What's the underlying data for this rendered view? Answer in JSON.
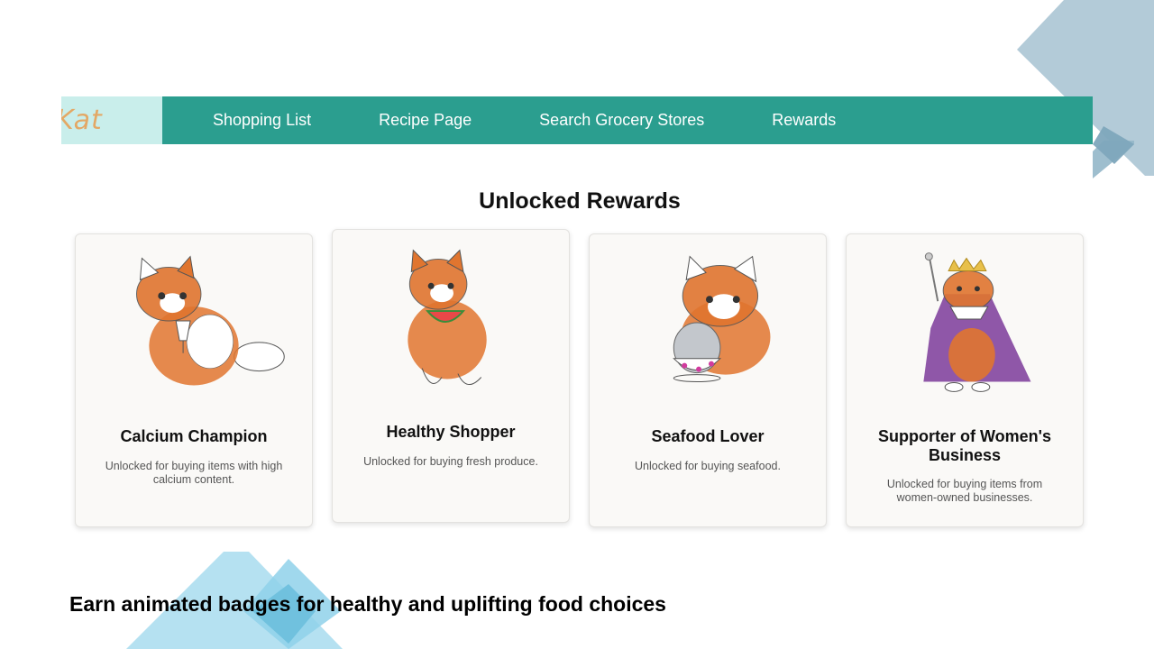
{
  "brand": {
    "logo_text": "Kat"
  },
  "nav": {
    "items": [
      {
        "label": "Shopping List"
      },
      {
        "label": "Recipe Page"
      },
      {
        "label": "Search Grocery Stores"
      },
      {
        "label": "Rewards"
      }
    ]
  },
  "main": {
    "heading": "Unlocked Rewards",
    "cards": [
      {
        "title": "Calcium Champion",
        "description": "Unlocked for buying items with high calcium content.",
        "art": "cat-with-milk-glass-icon"
      },
      {
        "title": "Healthy Shopper",
        "description": "Unlocked for buying fresh produce.",
        "art": "cat-with-watermelon-icon"
      },
      {
        "title": "Seafood Lover",
        "description": "Unlocked for buying seafood.",
        "art": "cat-with-shaved-ice-icon"
      },
      {
        "title": "Supporter of Women's Business",
        "description": "Unlocked for buying items from women-owned businesses.",
        "art": "cat-queen-with-crown-icon"
      }
    ]
  },
  "caption": "Earn animated badges for healthy and uplifting food choices",
  "colors": {
    "nav_bg": "#2b9e8f",
    "logo_bg": "#c9eeeb",
    "logo_text": "#e3a865",
    "deco_top": "#a9c3d3",
    "deco_bottom": "#9fd8ee",
    "cat_orange": "#e0752f",
    "crown_gold": "#e8c04a",
    "robe_purple": "#7b3b9a"
  }
}
